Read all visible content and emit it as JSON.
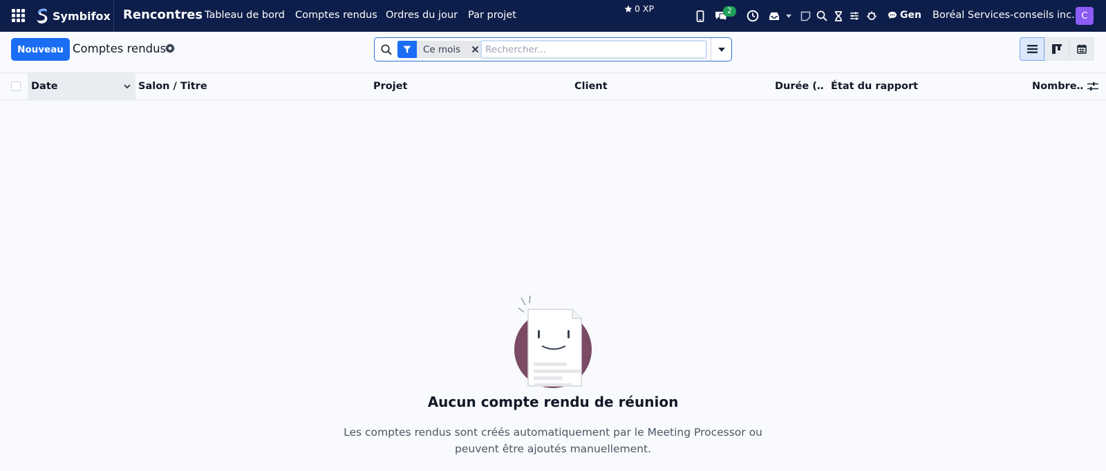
{
  "navbar": {
    "brand": "Symbifox",
    "app_name": "Rencontres",
    "menus": [
      "Tableau de bord",
      "Comptes rendus",
      "Ordres du jour",
      "Par projet"
    ],
    "xp": "0 XP",
    "messages_badge": "2",
    "gen_label": "Gen",
    "company": "Boréal Services-conseils inc.",
    "avatar_letter": "C",
    "icons": [
      "mobile-icon",
      "chat-icon",
      "clock-icon",
      "inbox-icon",
      "caret-down-icon",
      "note-icon",
      "search-icon",
      "hourglass-icon",
      "sliders-icon",
      "bug-icon",
      "chat-bubble-icon"
    ]
  },
  "control_panel": {
    "new_button": "Nouveau",
    "title": "Comptes rendus",
    "search": {
      "facet": "Ce mois",
      "placeholder": "Rechercher..."
    },
    "views": [
      "list-view",
      "kanban-view",
      "calendar-view"
    ],
    "active_view": "list-view"
  },
  "list": {
    "columns": [
      "Date",
      "Salon / Titre",
      "Projet",
      "Client",
      "Durée (…",
      "État du rapport",
      "Nombre…"
    ],
    "sorted_column": "Date"
  },
  "empty_state": {
    "title": "Aucun compte rendu de réunion",
    "description": "Les comptes rendus sont créés automatiquement par le Meeting Processor ou peuvent être ajoutés manuellement."
  },
  "colors": {
    "navbar": "#0e1e4a",
    "primary": "#1b6ef3",
    "badge": "#1e9e57",
    "avatar": "#8b5cf6",
    "illustration_circle": "#7b4a64"
  }
}
